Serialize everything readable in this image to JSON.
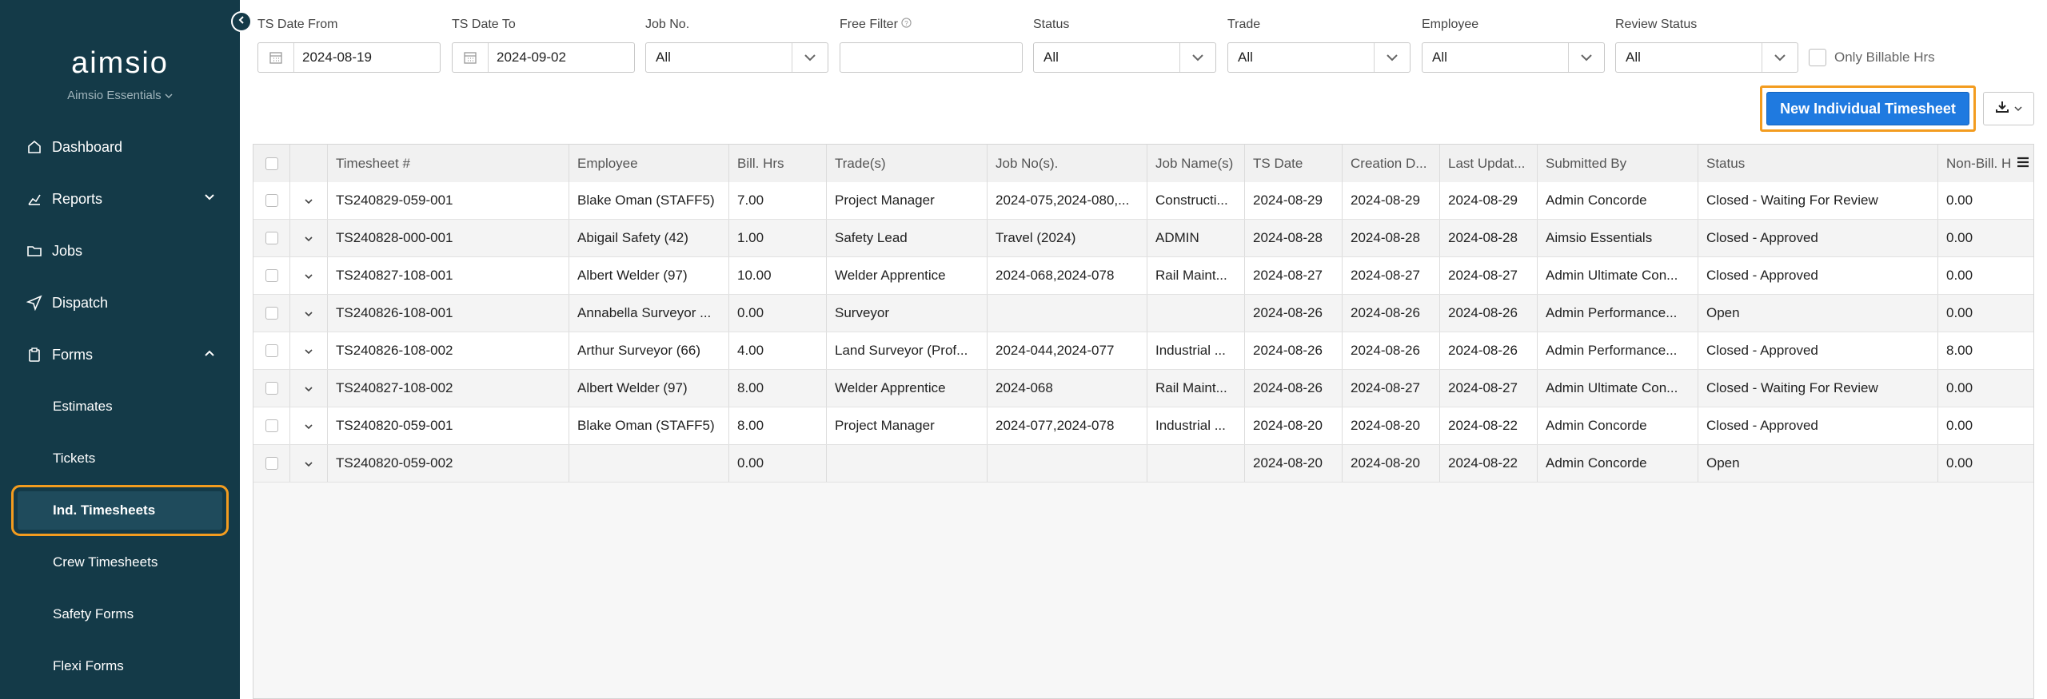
{
  "sidebar": {
    "brand": "aimsio",
    "org": "Aimsio Essentials",
    "items": [
      {
        "label": "Dashboard"
      },
      {
        "label": "Reports"
      },
      {
        "label": "Jobs"
      },
      {
        "label": "Dispatch"
      },
      {
        "label": "Forms"
      }
    ],
    "forms_sub": [
      {
        "label": "Estimates"
      },
      {
        "label": "Tickets"
      },
      {
        "label": "Ind. Timesheets"
      },
      {
        "label": "Crew Timesheets"
      },
      {
        "label": "Safety Forms"
      },
      {
        "label": "Flexi Forms"
      }
    ]
  },
  "filters": {
    "ts_date_from": {
      "label": "TS Date From",
      "value": "2024-08-19"
    },
    "ts_date_to": {
      "label": "TS Date To",
      "value": "2024-09-02"
    },
    "job_no": {
      "label": "Job No.",
      "value": "All"
    },
    "free_filter": {
      "label": "Free Filter",
      "value": ""
    },
    "status": {
      "label": "Status",
      "value": "All"
    },
    "trade": {
      "label": "Trade",
      "value": "All"
    },
    "employee": {
      "label": "Employee",
      "value": "All"
    },
    "review_status": {
      "label": "Review Status",
      "value": "All"
    },
    "only_billable": {
      "label": "Only Billable Hrs"
    }
  },
  "toolbar": {
    "new_button": "New Individual Timesheet"
  },
  "table": {
    "headers": [
      "Timesheet #",
      "Employee",
      "Bill. Hrs",
      "Trade(s)",
      "Job No(s).",
      "Job Name(s)",
      "TS Date",
      "Creation D...",
      "Last Updat...",
      "Submitted By",
      "Status",
      "Non-Bill. H"
    ],
    "rows": [
      [
        "TS240829-059-001",
        "Blake Oman (STAFF5)",
        "7.00",
        "Project Manager",
        "2024-075,2024-080,...",
        "Constructi...",
        "2024-08-29",
        "2024-08-29",
        "2024-08-29",
        "Admin Concorde",
        "Closed - Waiting For Review",
        "0.00"
      ],
      [
        "TS240828-000-001",
        "Abigail Safety (42)",
        "1.00",
        "Safety Lead",
        "Travel (2024)",
        "ADMIN",
        "2024-08-28",
        "2024-08-28",
        "2024-08-28",
        "Aimsio Essentials",
        "Closed - Approved",
        "0.00"
      ],
      [
        "TS240827-108-001",
        "Albert Welder (97)",
        "10.00",
        "Welder Apprentice",
        "2024-068,2024-078",
        "Rail Maint...",
        "2024-08-27",
        "2024-08-27",
        "2024-08-27",
        "Admin Ultimate Con...",
        "Closed - Approved",
        "0.00"
      ],
      [
        "TS240826-108-001",
        "Annabella Surveyor ...",
        "0.00",
        "Surveyor",
        "",
        "",
        "2024-08-26",
        "2024-08-26",
        "2024-08-26",
        "Admin Performance...",
        "Open",
        "0.00"
      ],
      [
        "TS240826-108-002",
        "Arthur Surveyor (66)",
        "4.00",
        "Land Surveyor (Prof...",
        "2024-044,2024-077",
        "Industrial ...",
        "2024-08-26",
        "2024-08-26",
        "2024-08-26",
        "Admin Performance...",
        "Closed - Approved",
        "8.00"
      ],
      [
        "TS240827-108-002",
        "Albert Welder (97)",
        "8.00",
        "Welder Apprentice",
        "2024-068",
        "Rail Maint...",
        "2024-08-26",
        "2024-08-27",
        "2024-08-27",
        "Admin Ultimate Con...",
        "Closed - Waiting For Review",
        "0.00"
      ],
      [
        "TS240820-059-001",
        "Blake Oman (STAFF5)",
        "8.00",
        "Project Manager",
        "2024-077,2024-078",
        "Industrial ...",
        "2024-08-20",
        "2024-08-20",
        "2024-08-22",
        "Admin Concorde",
        "Closed - Approved",
        "0.00"
      ],
      [
        "TS240820-059-002",
        "",
        "0.00",
        "",
        "",
        "",
        "2024-08-20",
        "2024-08-20",
        "2024-08-22",
        "Admin Concorde",
        "Open",
        "0.00"
      ]
    ]
  }
}
